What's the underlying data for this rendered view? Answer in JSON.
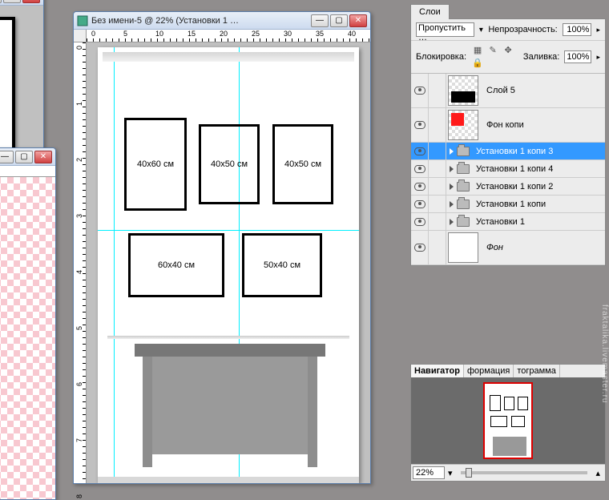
{
  "small_window": {
    "buttons": [
      "—",
      "▢",
      "✕"
    ]
  },
  "main_window": {
    "title": "Без имени-5 @ 22% (Установки 1 …",
    "buttons": [
      "—",
      "▢",
      "✕"
    ],
    "ruler_h_labels": [
      "0",
      "5",
      "10",
      "15",
      "20",
      "25",
      "30",
      "35",
      "40"
    ],
    "ruler_v_labels": [
      "0",
      "1",
      "2",
      "3",
      "4",
      "5",
      "6",
      "7",
      "8"
    ],
    "frames": [
      {
        "label": "40x60 см"
      },
      {
        "label": "40x50 см"
      },
      {
        "label": "40x50 см"
      },
      {
        "label": "60x40 см"
      },
      {
        "label": "50x40 см"
      }
    ]
  },
  "layers_panel": {
    "tab": "Слои",
    "blend_mode": "Пропустить …",
    "opacity_label": "Непрозрачность:",
    "opacity_value": "100%",
    "lock_label": "Блокировка:",
    "fill_label": "Заливка:",
    "fill_value": "100%",
    "layers": [
      {
        "name": "Слой 5",
        "type": "pixel",
        "thumb": "black-bar"
      },
      {
        "name": "Фон копи",
        "type": "pixel",
        "thumb": "red-square"
      },
      {
        "name": "Установки 1 копи 3",
        "type": "group",
        "selected": true
      },
      {
        "name": "Установки 1 копи 4",
        "type": "group"
      },
      {
        "name": "Установки 1 копи 2",
        "type": "group"
      },
      {
        "name": "Установки 1 копи",
        "type": "group"
      },
      {
        "name": "Установки 1",
        "type": "group"
      },
      {
        "name": "Фон",
        "type": "pixel",
        "thumb": "white-page",
        "italic": true
      }
    ]
  },
  "navigator": {
    "tabs": [
      "Навигатор",
      "формация",
      "тограмма"
    ],
    "zoom": "22%"
  },
  "watermark": "fraktalika.livemaster.ru"
}
